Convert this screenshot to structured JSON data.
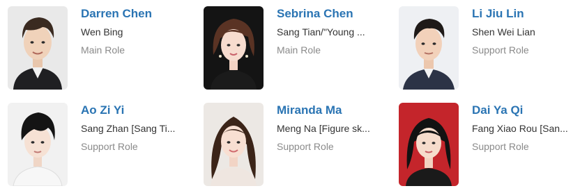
{
  "cast": [
    {
      "name": "Darren Chen",
      "character": "Wen Bing",
      "role": "Main Role",
      "photo_icon": "actor-portrait"
    },
    {
      "name": "Sebrina Chen",
      "character": "Sang Tian/\"Young ...",
      "role": "Main Role",
      "photo_icon": "actor-portrait"
    },
    {
      "name": "Li Jiu Lin",
      "character": "Shen Wei Lian",
      "role": "Support Role",
      "photo_icon": "actor-portrait"
    },
    {
      "name": "Ao Zi Yi",
      "character": "Sang Zhan [Sang Ti...",
      "role": "Support Role",
      "photo_icon": "actor-portrait"
    },
    {
      "name": "Miranda Ma",
      "character": "Meng Na [Figure sk...",
      "role": "Support Role",
      "photo_icon": "actor-portrait"
    },
    {
      "name": "Dai Ya Qi",
      "character": "Fang Xiao Rou [San...",
      "role": "Support Role",
      "photo_icon": "actor-portrait"
    }
  ],
  "colors": {
    "name_link": "#2a74b3",
    "character_text": "#333333",
    "role_text": "#8a8a8a"
  }
}
